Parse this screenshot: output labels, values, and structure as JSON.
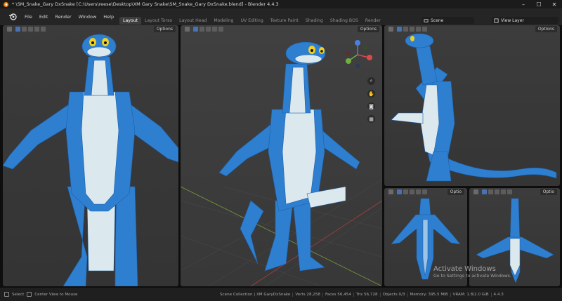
{
  "window": {
    "title": "* \\SM_Snake_Gary DxSnake [C:\\Users\\reese\\Desktop\\XM Gary Snake\\SM_Snake_Gary DxSnake.blend] - Blender 4.4.3",
    "minimize": "–",
    "maximize": "☐",
    "close": "✕"
  },
  "menu": [
    "File",
    "Edit",
    "Render",
    "Window",
    "Help"
  ],
  "workspace_tabs": [
    {
      "label": "Layout",
      "active": true
    },
    {
      "label": "Layout Torso",
      "active": false
    },
    {
      "label": "Layout Head",
      "active": false
    },
    {
      "label": "Modeling",
      "active": false
    },
    {
      "label": "UV Editing",
      "active": false
    },
    {
      "label": "Texture Paint",
      "active": false
    },
    {
      "label": "Shading",
      "active": false
    },
    {
      "label": "Shading BOS",
      "active": false
    },
    {
      "label": "Render",
      "active": false
    }
  ],
  "scene_label": "Scene",
  "view_layer_label": "View Layer",
  "viewports": {
    "options_label": "Options",
    "options_label_short": "Optio"
  },
  "watermark": {
    "line1": "Activate Windows",
    "line2": "Go to Settings to activate Windows."
  },
  "status": {
    "select": "Select",
    "center_view": "Center View to Mouse",
    "items": [
      "Scene Collection | XM GaryDxSnake",
      "Verts 28,258",
      "Faces 56,454",
      "Tris 56,728",
      "Objects 0/3",
      "Memory: 395.5 MiB",
      "VRAM: 1.8/2.0 GiB",
      "4.4.3"
    ]
  },
  "colors": {
    "accent": "#4772b3",
    "snake_blue": "#2f7fd0",
    "snake_belly": "#dbe9ee"
  }
}
